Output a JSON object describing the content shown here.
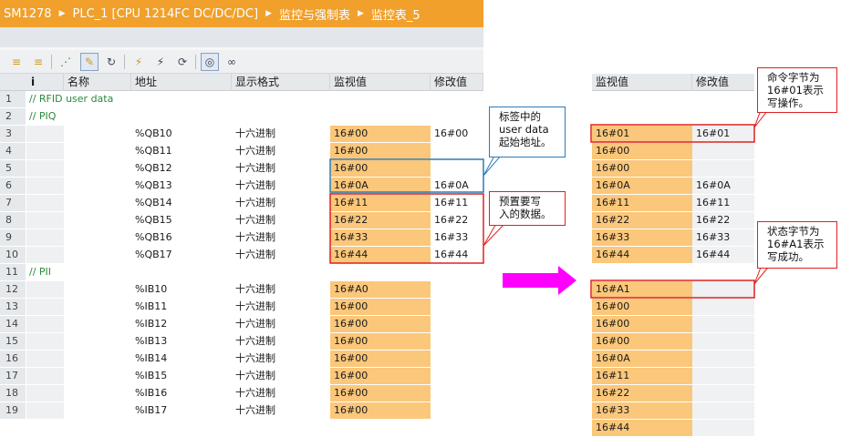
{
  "breadcrumb": [
    "SM1278",
    "PLC_1 [CPU 1214FC DC/DC/DC]",
    "监控与强制表",
    "监控表_5"
  ],
  "columns": {
    "info": "i",
    "name": "名称",
    "address": "地址",
    "format": "显示格式",
    "monitor": "监视值",
    "modify": "修改值"
  },
  "rows": [
    {
      "num": "1",
      "comment": "// RFID user data"
    },
    {
      "num": "2",
      "comment": "// PIQ"
    },
    {
      "num": "3",
      "address": "%QB10",
      "format": "十六进制",
      "monitor": "16#00",
      "modify": "16#00"
    },
    {
      "num": "4",
      "address": "%QB11",
      "format": "十六进制",
      "monitor": "16#00",
      "modify": ""
    },
    {
      "num": "5",
      "address": "%QB12",
      "format": "十六进制",
      "monitor": "16#00",
      "modify": ""
    },
    {
      "num": "6",
      "address": "%QB13",
      "format": "十六进制",
      "monitor": "16#0A",
      "modify": "16#0A"
    },
    {
      "num": "7",
      "address": "%QB14",
      "format": "十六进制",
      "monitor": "16#11",
      "modify": "16#11"
    },
    {
      "num": "8",
      "address": "%QB15",
      "format": "十六进制",
      "monitor": "16#22",
      "modify": "16#22"
    },
    {
      "num": "9",
      "address": "%QB16",
      "format": "十六进制",
      "monitor": "16#33",
      "modify": "16#33"
    },
    {
      "num": "10",
      "address": "%QB17",
      "format": "十六进制",
      "monitor": "16#44",
      "modify": "16#44"
    },
    {
      "num": "11",
      "comment": "// PII"
    },
    {
      "num": "12",
      "address": "%IB10",
      "format": "十六进制",
      "monitor": "16#A0",
      "modify": ""
    },
    {
      "num": "13",
      "address": "%IB11",
      "format": "十六进制",
      "monitor": "16#00",
      "modify": ""
    },
    {
      "num": "14",
      "address": "%IB12",
      "format": "十六进制",
      "monitor": "16#00",
      "modify": ""
    },
    {
      "num": "15",
      "address": "%IB13",
      "format": "十六进制",
      "monitor": "16#00",
      "modify": ""
    },
    {
      "num": "16",
      "address": "%IB14",
      "format": "十六进制",
      "monitor": "16#00",
      "modify": ""
    },
    {
      "num": "17",
      "address": "%IB15",
      "format": "十六进制",
      "monitor": "16#00",
      "modify": ""
    },
    {
      "num": "18",
      "address": "%IB16",
      "format": "十六进制",
      "monitor": "16#00",
      "modify": ""
    },
    {
      "num": "19",
      "address": "%IB17",
      "format": "十六进制",
      "monitor": "16#00",
      "modify": ""
    }
  ],
  "right_panel": {
    "header_monitor": "监视值",
    "header_modify": "修改值",
    "rows": [
      {
        "monitor": "",
        "modify": ""
      },
      {
        "monitor": "",
        "modify": ""
      },
      {
        "monitor": "16#01",
        "modify": "16#01"
      },
      {
        "monitor": "16#00",
        "modify": ""
      },
      {
        "monitor": "16#00",
        "modify": ""
      },
      {
        "monitor": "16#0A",
        "modify": "16#0A"
      },
      {
        "monitor": "16#11",
        "modify": "16#11"
      },
      {
        "monitor": "16#22",
        "modify": "16#22"
      },
      {
        "monitor": "16#33",
        "modify": "16#33"
      },
      {
        "monitor": "16#44",
        "modify": "16#44"
      },
      {
        "monitor": "",
        "modify": ""
      },
      {
        "monitor": "16#A1",
        "modify": ""
      },
      {
        "monitor": "16#00",
        "modify": ""
      },
      {
        "monitor": "16#00",
        "modify": ""
      },
      {
        "monitor": "16#00",
        "modify": ""
      },
      {
        "monitor": "16#0A",
        "modify": ""
      },
      {
        "monitor": "16#11",
        "modify": ""
      },
      {
        "monitor": "16#22",
        "modify": ""
      },
      {
        "monitor": "16#33",
        "modify": ""
      },
      {
        "monitor": "16#44",
        "modify": ""
      }
    ]
  },
  "callouts": {
    "start_address": "标签中的\nuser data\n起始地址。",
    "preset_data": "预置要写\n入的数据。",
    "command_byte": "命令字节为\n16#01表示\n写操作。",
    "status_byte": "状态字节为\n16#A1表示\n写成功。"
  },
  "toolbar_icons": [
    "add-row-icon",
    "insert-row-icon",
    "modify-once-icon",
    "modify-icon",
    "monitor-cycle-icon",
    "force-icon",
    "unforce-icon",
    "refresh-icon",
    "monitor-all-icon",
    "glasses-icon"
  ],
  "colors": {
    "title_bar": "#f0a02b",
    "monitor_cell": "#fbc77a",
    "comment_text": "#2a8a3a",
    "red_box": "#e02020",
    "blue_box": "#2b7bb9",
    "arrow": "#ff00ff"
  }
}
